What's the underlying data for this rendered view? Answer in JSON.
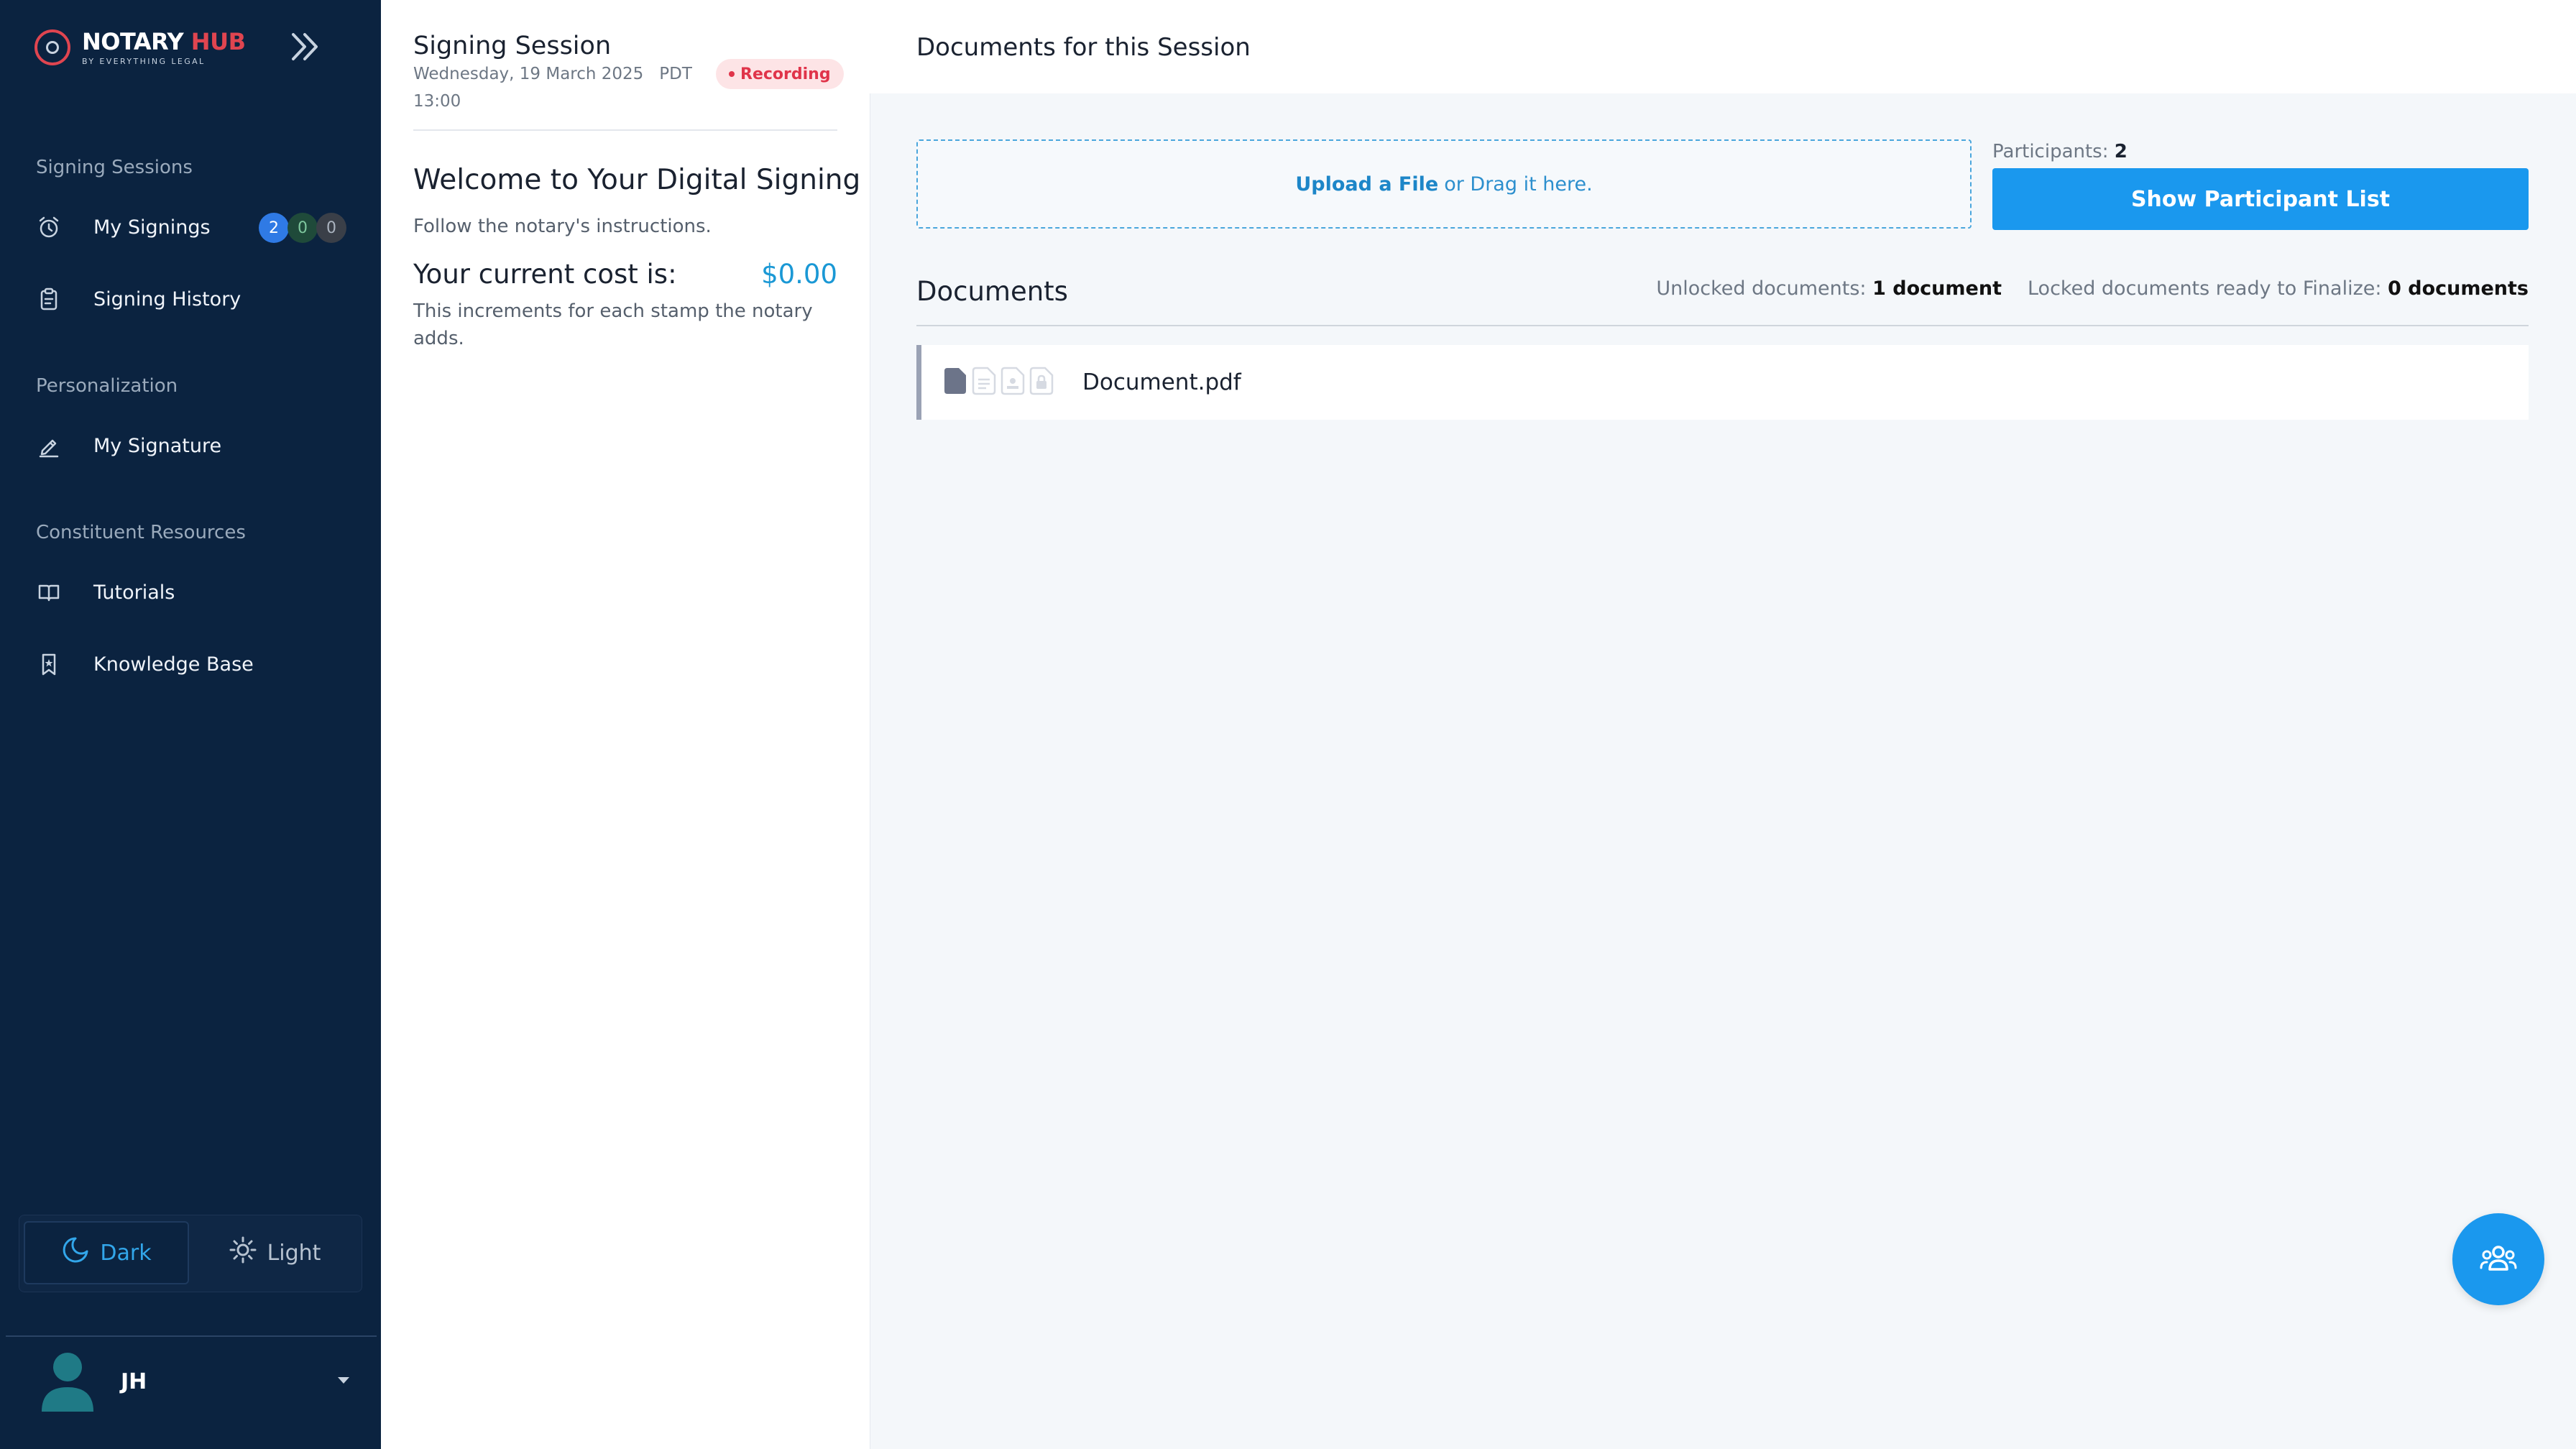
{
  "brand": {
    "name_part1": "NOTARY",
    "name_part2": "HUB",
    "tagline": "BY EVERYTHING LEGAL",
    "accent": "#e04550"
  },
  "sidebar": {
    "sections": [
      {
        "title": "Signing Sessions"
      },
      {
        "title": "Personalization"
      },
      {
        "title": "Constituent Resources"
      }
    ],
    "items": [
      {
        "label": "My Signings",
        "icon": "alarm-clock-icon",
        "badges": [
          "2",
          "0",
          "0"
        ]
      },
      {
        "label": "Signing History",
        "icon": "clipboard-icon"
      },
      {
        "label": "My Signature",
        "icon": "pen-icon"
      },
      {
        "label": "Tutorials",
        "icon": "book-icon"
      },
      {
        "label": "Knowledge Base",
        "icon": "bookmark-icon"
      }
    ],
    "theme": {
      "dark_label": "Dark",
      "light_label": "Light",
      "selected": "Dark"
    },
    "user": {
      "initials": "JH"
    }
  },
  "session": {
    "title": "Signing Session",
    "date": "Wednesday, 19 March 2025",
    "timezone": "PDT",
    "time": "13:00",
    "status": "Recording",
    "welcome": "Welcome to Your Digital Signing",
    "instructions": "Follow the notary's instructions.",
    "cost_label": "Your current cost is:",
    "cost_value": "$0.00",
    "cost_note": "This increments for each stamp the notary adds."
  },
  "main": {
    "title": "Documents for this Session",
    "upload": {
      "link": "Upload a File",
      "rest": "or Drag it here."
    },
    "participants_label": "Participants:",
    "participants_count": "2",
    "show_participants": "Show Participant List",
    "documents_title": "Documents",
    "unlocked_label": "Unlocked documents:",
    "unlocked_value": "1 document",
    "locked_label": "Locked documents ready to Finalize:",
    "locked_value": "0 documents",
    "documents": [
      {
        "name": "Document.pdf"
      }
    ]
  },
  "colors": {
    "sidebar_bg": "#0b2340",
    "primary": "#1a98ee",
    "cost": "#1a98d5",
    "recording": "#e0344a"
  }
}
